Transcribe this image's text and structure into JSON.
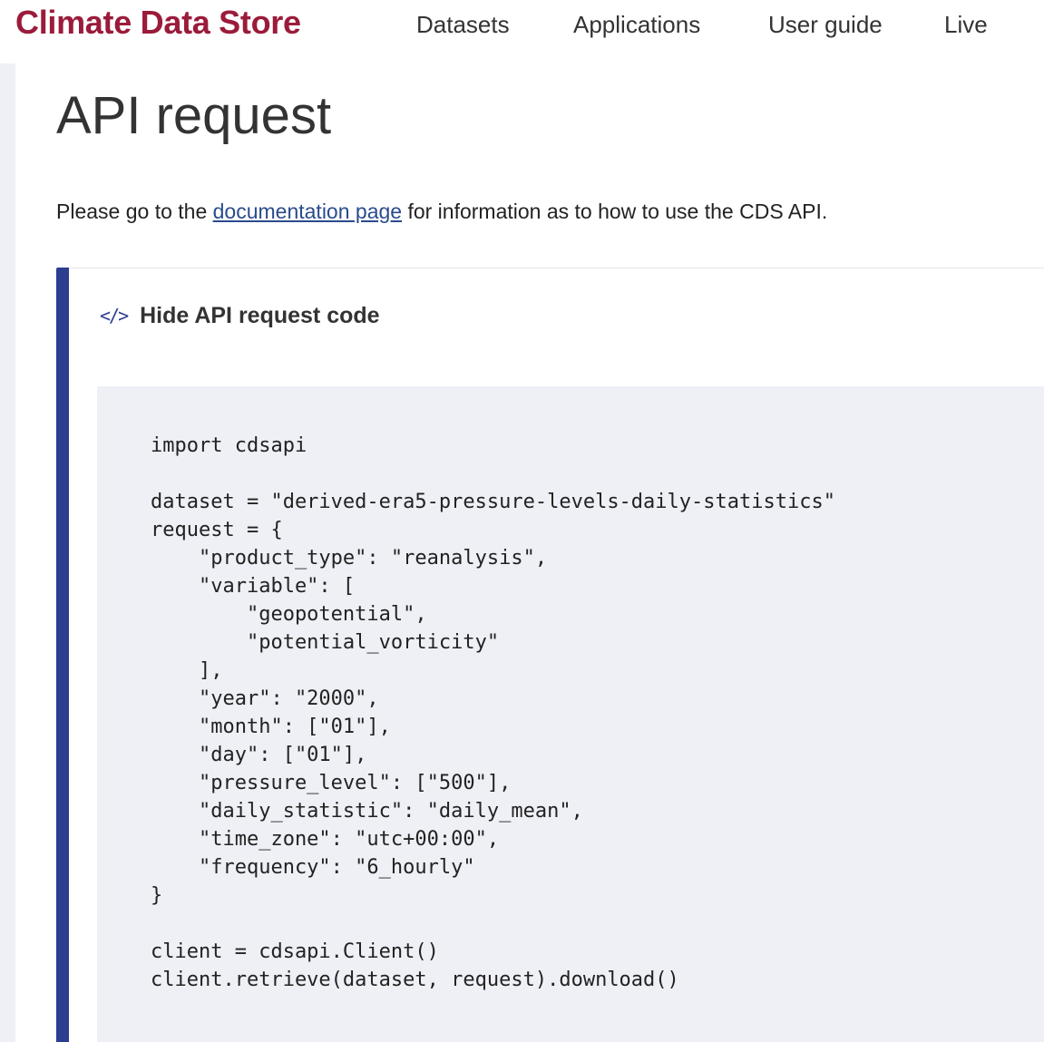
{
  "header": {
    "brand": "Climate Data Store",
    "nav": [
      "Datasets",
      "Applications",
      "User guide",
      "Live"
    ]
  },
  "page": {
    "title": "API request",
    "intro_before": "Please go to the ",
    "intro_link": "documentation page",
    "intro_after": " for information as to how to use the CDS API."
  },
  "panel": {
    "toggle_icon": "code-icon",
    "toggle_label": "Hide API request code",
    "code": "import cdsapi\n\ndataset = \"derived-era5-pressure-levels-daily-statistics\"\nrequest = {\n    \"product_type\": \"reanalysis\",\n    \"variable\": [\n        \"geopotential\",\n        \"potential_vorticity\"\n    ],\n    \"year\": \"2000\",\n    \"month\": [\"01\"],\n    \"day\": [\"01\"],\n    \"pressure_level\": [\"500\"],\n    \"daily_statistic\": \"daily_mean\",\n    \"time_zone\": \"utc+00:00\",\n    \"frequency\": \"6_hourly\"\n}\n\nclient = cdsapi.Client()\nclient.retrieve(dataset, request).download()"
  },
  "colors": {
    "brand": "#9b1b3a",
    "accent": "#2c3e8f",
    "link": "#2a4b8d",
    "code_bg": "#eff0f6"
  }
}
